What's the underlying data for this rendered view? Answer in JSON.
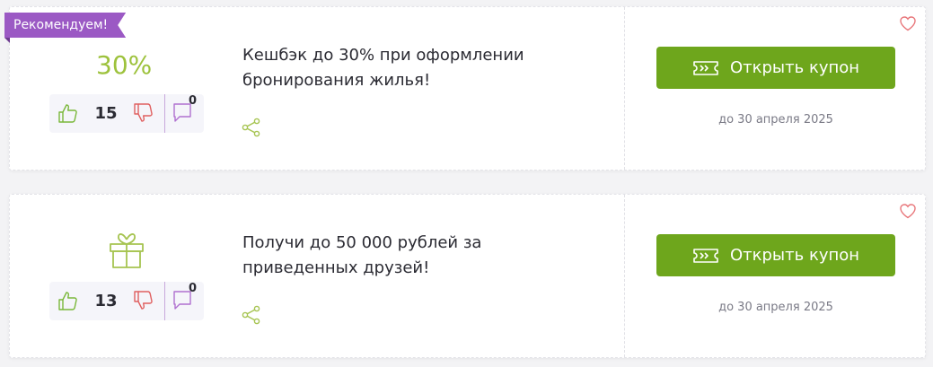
{
  "offers": [
    {
      "badge": "Рекомендуем!",
      "discount": "30%",
      "likes": "15",
      "comments": "0",
      "title": "Кешбэк до 30% при оформлении бронирования жилья!",
      "button_label": "Открыть купон",
      "expiry": "до 30 апреля 2025"
    },
    {
      "icon": "gift-icon",
      "likes": "13",
      "comments": "0",
      "title": "Получи до 50 000 рублей за приведенных друзей!",
      "button_label": "Открыть купон",
      "expiry": "до 30 апреля 2025"
    }
  ],
  "colors": {
    "accent_green": "#6ea61c",
    "discount_green": "#9dc23c",
    "badge_purple": "#9b59c4",
    "heart_red": "#e8767a"
  }
}
